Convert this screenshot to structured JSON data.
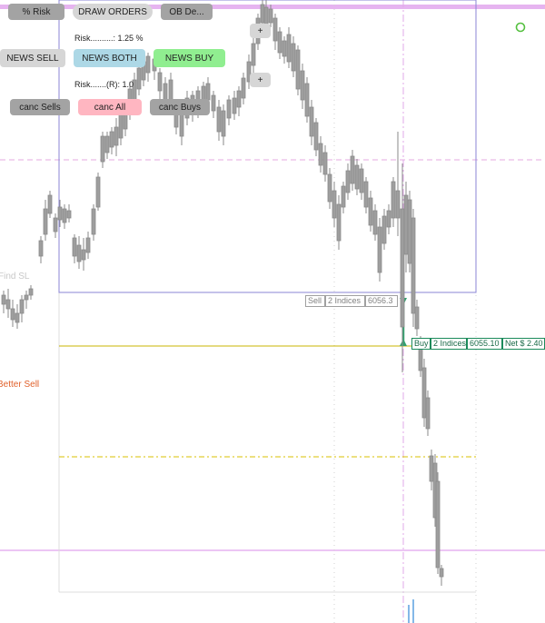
{
  "colors": {
    "up_candle": "#ffffff",
    "down_candle": "#9e9e9e",
    "wick": "#8a8a8a",
    "order_box": "#8b86d6",
    "sell_accent": "#33a06f",
    "buy_accent": "#1a8a5a",
    "yellow_line": "#c8b400",
    "pink_line": "#e0b0f0"
  },
  "buttons": {
    "risk_pct": "% Risk",
    "draw_orders": "DRAW ORDERS",
    "ob_de": "OB De...",
    "plus_top": "+",
    "plus_bottom": "+",
    "news_sell": "NEWS SELL",
    "news_both": "NEWS BOTH",
    "news_buy": "NEWS BUY",
    "canc_sells": "canc Sells",
    "canc_all": "canc All",
    "canc_buys": "canc Buys"
  },
  "labels": {
    "risk_line": "Risk..........: 1.25 %",
    "risk_r_line": "Risk.......(R): 1.0",
    "find_sl": "Find SL",
    "better_sell": "Better Sell"
  },
  "sell_order": {
    "side": "Sell",
    "qty": "2 Indices",
    "price": "6056.3"
  },
  "buy_order": {
    "side": "Buy",
    "qty": "2 Indices",
    "price": "6055.10",
    "net": "Net $ 2.40"
  },
  "status_icon": "circle-status-icon"
}
